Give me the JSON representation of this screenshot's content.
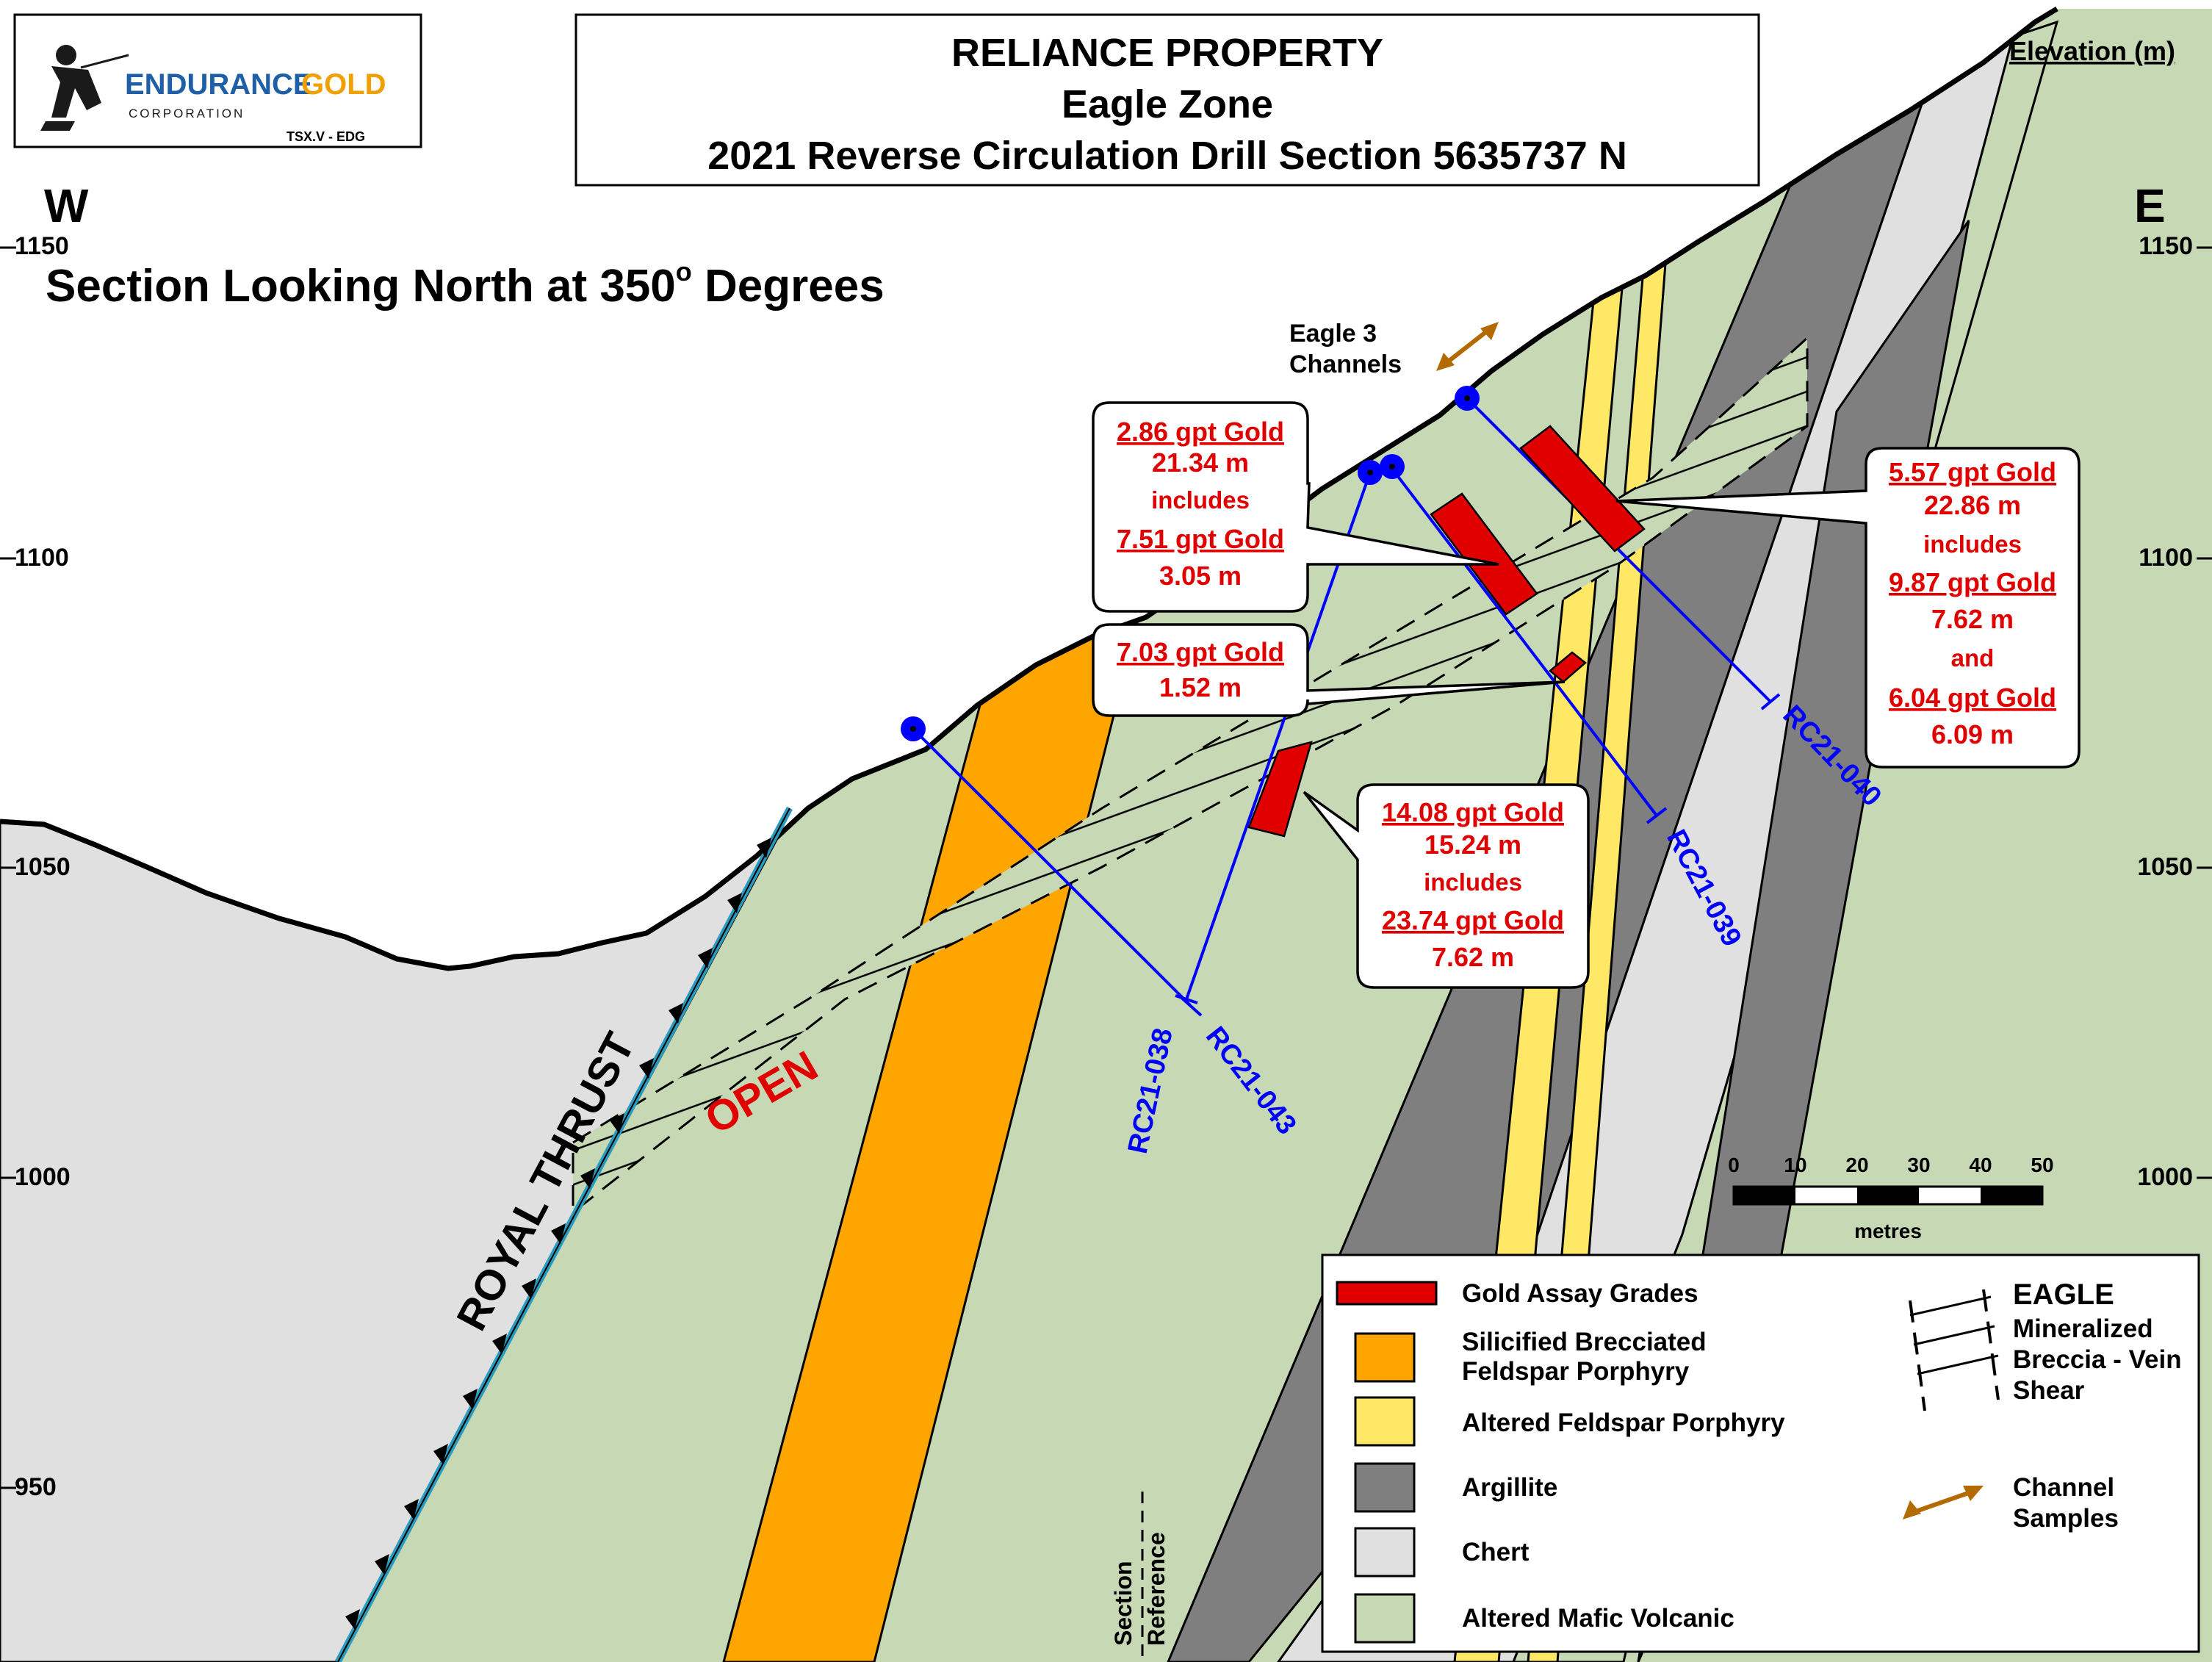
{
  "logo": {
    "company": "ENDURANCE",
    "company_accent": "GOLD",
    "corporation": "CORPORATION",
    "ticker": "TSX.V - EDG"
  },
  "title": {
    "line1": "RELIANCE PROPERTY",
    "line2": "Eagle Zone",
    "line3": "2021 Reverse Circulation Drill Section 5635737 N"
  },
  "directions": {
    "west": "W",
    "east": "E"
  },
  "subtitle": {
    "text": "Section Looking North at 350",
    "degree": "o",
    "suffix": " Degrees"
  },
  "elevation": {
    "label": "Elevation (m)",
    "ticks": [
      "1150",
      "1100",
      "1050",
      "1000",
      "950"
    ]
  },
  "features": {
    "royal_thrust": "ROYAL THRUST",
    "open": "OPEN",
    "eagle3_channels_line1": "Eagle 3",
    "eagle3_channels_line2": "Channels",
    "section_reference_line1": "Section",
    "section_reference_line2": "Reference"
  },
  "drill_holes": [
    "RC21-038",
    "RC21-043",
    "RC21-039",
    "RC21-040"
  ],
  "callouts": {
    "c1": [
      "2.86 gpt Gold",
      "21.34 m",
      "includes",
      "7.51 gpt Gold",
      "3.05 m"
    ],
    "c2": [
      "7.03 gpt Gold",
      "1.52 m"
    ],
    "c3": [
      "14.08 gpt Gold",
      "15.24 m",
      "includes",
      "23.74 gpt Gold",
      "7.62 m"
    ],
    "c4": [
      "5.57 gpt Gold",
      "22.86 m",
      "includes",
      "9.87 gpt Gold",
      "7.62 m",
      "and",
      "6.04 gpt Gold",
      "6.09 m"
    ]
  },
  "scale_bar": {
    "ticks": [
      "0",
      "10",
      "20",
      "30",
      "40",
      "50"
    ],
    "unit": "metres"
  },
  "legend": {
    "items": [
      {
        "line1": "Gold Assay Grades",
        "line2": ""
      },
      {
        "line1": "Silicified Brecciated",
        "line2": "Feldspar Porphyry"
      },
      {
        "line1": "Altered Feldspar Porphyry",
        "line2": ""
      },
      {
        "line1": "Argillite",
        "line2": ""
      },
      {
        "line1": "Chert",
        "line2": ""
      },
      {
        "line1": "Altered Mafic Volcanic",
        "line2": ""
      }
    ],
    "eagle": {
      "title": "EAGLE",
      "line1": "Mineralized",
      "line2": "Breccia - Vein",
      "line3": "Shear"
    },
    "channel": {
      "line1": "Channel",
      "line2": "Samples"
    }
  },
  "colors": {
    "gold_assay": "#e00000",
    "silicified_porphyry": "#ffa500",
    "altered_porphyry": "#ffe866",
    "argillite": "#7f7f7f",
    "chert": "#e0e0e0",
    "mafic_volcanic": "#c6d9b4",
    "drill_hole": "#0000ff",
    "callout_text": "#e00000",
    "thrust": "#2a9bbf",
    "channel_arrow": "#b36b00",
    "logo_blue": "#1f5fa8",
    "logo_gold": "#f0a000"
  }
}
